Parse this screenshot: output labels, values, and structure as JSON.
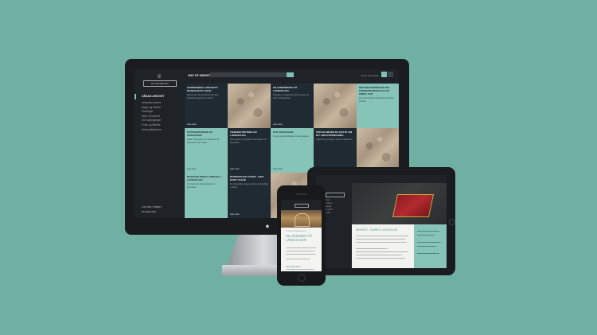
{
  "desktop": {
    "logo_text": "ROSENBORG",
    "sidebar": {
      "active": "SÅDAN ARKIVET",
      "items": [
        "Arkivdokumenter",
        "Bøger og billeder",
        "Samlinger",
        "Mere om arkivet",
        "Kort og tegninger",
        "Fotos og billeder",
        "Arkivpublikationer"
      ],
      "footer": [
        "LOG IND / OPRET",
        "DK ENGLISH"
      ]
    },
    "topbar": {
      "label": "SØG PÅ WEBSITET",
      "lang": "Du er på: Dansk"
    },
    "tiles": [
      {
        "title": "SCRIBENDEN I ARKIVETS BASEN QUOT (1674)",
        "desc": "Beskrivelse af dokumentet og dets historiske baggrund i arkivet.",
        "more": "Læs mere"
      },
      {
        "title": "HILLERØDBORG PÅ LÆSESALEN",
        "desc": "Få hjælp og vejledning på læsesalen til dine undersøgelser.",
        "more": "Læs mere"
      },
      {
        "title": "REGNSKABSBØGER FRA FREDERIKSBORG SLOTS KIRKE 1620",
        "desc": "Om de bevarede regnskaber og deres indhold.",
        "more": "Læs mere"
      },
      {
        "title": "FOTOGRAFERING AF ARKIVALIER",
        "desc": "Sådan fotograferer du arkivalier på læsesalen efter aftale.",
        "more": "Læs mere"
      },
      {
        "title": "TRÆNER RETNING ER LÆSESALEN",
        "desc": "Åbningstider og praktisk information om læsesalen.",
        "more": "Læs mere"
      },
      {
        "title": "NYE ARKIVALIER",
        "desc": "Se de seneste tilføjelser til samlingerne.",
        "more": "Læs mere"
      },
      {
        "title": "SÅDAN SØGER DU DETTE OM DIT ARKIVSPØRGSMÅL",
        "desc": "Vejledning i at søge i arkivets databaser.",
        "more": "Læs mere"
      },
      {
        "title": "BOGSAMLINGER LÆSESAL I LÆSESALEN",
        "desc": "Oversigt over bogsamlingerne i læsesalen.",
        "more": "Læs mere"
      },
      {
        "title": "BORGERLIGE SAGER - DEN SODT I DAGE",
        "desc": "Om borgerlige sager og deres behandling i arkivet.",
        "more": "Læs mere"
      },
      {
        "title": "ARKIV I RIGSARKIVETS SAMLINGER",
        "desc": "",
        "more": ""
      }
    ]
  },
  "tablet": {
    "article_title": "INDHENT - SÆBES LÆSESALEN",
    "nav": [
      "Arkivet",
      "Samlinger",
      "Læsesal",
      "Om arkivet",
      "Kontakt"
    ]
  },
  "phone": {
    "tag": "NYHEDER FRA ARKIVET",
    "title": "HILJÆDNING PÅ LÆSESALEN",
    "subtitle": "HILJÆDNING"
  }
}
